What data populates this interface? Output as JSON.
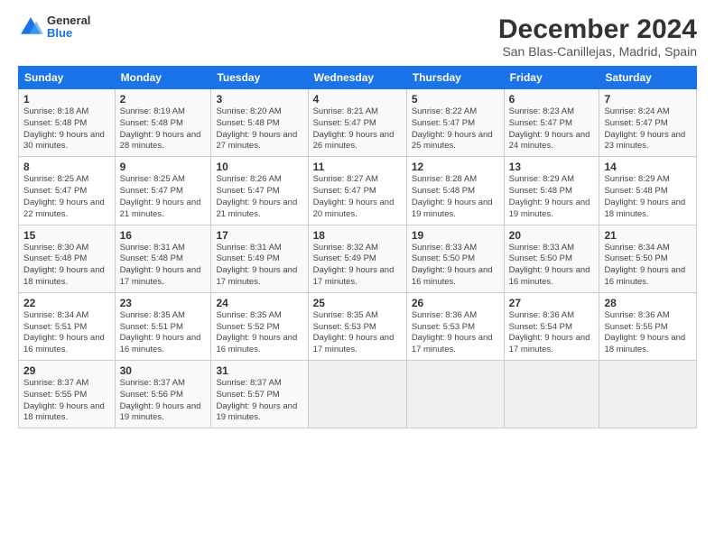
{
  "header": {
    "logo_general": "General",
    "logo_blue": "Blue",
    "title": "December 2024",
    "subtitle": "San Blas-Canillejas, Madrid, Spain"
  },
  "calendar": {
    "headers": [
      "Sunday",
      "Monday",
      "Tuesday",
      "Wednesday",
      "Thursday",
      "Friday",
      "Saturday"
    ],
    "weeks": [
      [
        {
          "day": "1",
          "sunrise": "8:18 AM",
          "sunset": "5:48 PM",
          "daylight": "9 hours and 30 minutes."
        },
        {
          "day": "2",
          "sunrise": "8:19 AM",
          "sunset": "5:48 PM",
          "daylight": "9 hours and 28 minutes."
        },
        {
          "day": "3",
          "sunrise": "8:20 AM",
          "sunset": "5:48 PM",
          "daylight": "9 hours and 27 minutes."
        },
        {
          "day": "4",
          "sunrise": "8:21 AM",
          "sunset": "5:47 PM",
          "daylight": "9 hours and 26 minutes."
        },
        {
          "day": "5",
          "sunrise": "8:22 AM",
          "sunset": "5:47 PM",
          "daylight": "9 hours and 25 minutes."
        },
        {
          "day": "6",
          "sunrise": "8:23 AM",
          "sunset": "5:47 PM",
          "daylight": "9 hours and 24 minutes."
        },
        {
          "day": "7",
          "sunrise": "8:24 AM",
          "sunset": "5:47 PM",
          "daylight": "9 hours and 23 minutes."
        }
      ],
      [
        {
          "day": "8",
          "sunrise": "8:25 AM",
          "sunset": "5:47 PM",
          "daylight": "9 hours and 22 minutes."
        },
        {
          "day": "9",
          "sunrise": "8:25 AM",
          "sunset": "5:47 PM",
          "daylight": "9 hours and 21 minutes."
        },
        {
          "day": "10",
          "sunrise": "8:26 AM",
          "sunset": "5:47 PM",
          "daylight": "9 hours and 21 minutes."
        },
        {
          "day": "11",
          "sunrise": "8:27 AM",
          "sunset": "5:47 PM",
          "daylight": "9 hours and 20 minutes."
        },
        {
          "day": "12",
          "sunrise": "8:28 AM",
          "sunset": "5:48 PM",
          "daylight": "9 hours and 19 minutes."
        },
        {
          "day": "13",
          "sunrise": "8:29 AM",
          "sunset": "5:48 PM",
          "daylight": "9 hours and 19 minutes."
        },
        {
          "day": "14",
          "sunrise": "8:29 AM",
          "sunset": "5:48 PM",
          "daylight": "9 hours and 18 minutes."
        }
      ],
      [
        {
          "day": "15",
          "sunrise": "8:30 AM",
          "sunset": "5:48 PM",
          "daylight": "9 hours and 18 minutes."
        },
        {
          "day": "16",
          "sunrise": "8:31 AM",
          "sunset": "5:48 PM",
          "daylight": "9 hours and 17 minutes."
        },
        {
          "day": "17",
          "sunrise": "8:31 AM",
          "sunset": "5:49 PM",
          "daylight": "9 hours and 17 minutes."
        },
        {
          "day": "18",
          "sunrise": "8:32 AM",
          "sunset": "5:49 PM",
          "daylight": "9 hours and 17 minutes."
        },
        {
          "day": "19",
          "sunrise": "8:33 AM",
          "sunset": "5:50 PM",
          "daylight": "9 hours and 16 minutes."
        },
        {
          "day": "20",
          "sunrise": "8:33 AM",
          "sunset": "5:50 PM",
          "daylight": "9 hours and 16 minutes."
        },
        {
          "day": "21",
          "sunrise": "8:34 AM",
          "sunset": "5:50 PM",
          "daylight": "9 hours and 16 minutes."
        }
      ],
      [
        {
          "day": "22",
          "sunrise": "8:34 AM",
          "sunset": "5:51 PM",
          "daylight": "9 hours and 16 minutes."
        },
        {
          "day": "23",
          "sunrise": "8:35 AM",
          "sunset": "5:51 PM",
          "daylight": "9 hours and 16 minutes."
        },
        {
          "day": "24",
          "sunrise": "8:35 AM",
          "sunset": "5:52 PM",
          "daylight": "9 hours and 16 minutes."
        },
        {
          "day": "25",
          "sunrise": "8:35 AM",
          "sunset": "5:53 PM",
          "daylight": "9 hours and 17 minutes."
        },
        {
          "day": "26",
          "sunrise": "8:36 AM",
          "sunset": "5:53 PM",
          "daylight": "9 hours and 17 minutes."
        },
        {
          "day": "27",
          "sunrise": "8:36 AM",
          "sunset": "5:54 PM",
          "daylight": "9 hours and 17 minutes."
        },
        {
          "day": "28",
          "sunrise": "8:36 AM",
          "sunset": "5:55 PM",
          "daylight": "9 hours and 18 minutes."
        }
      ],
      [
        {
          "day": "29",
          "sunrise": "8:37 AM",
          "sunset": "5:55 PM",
          "daylight": "9 hours and 18 minutes."
        },
        {
          "day": "30",
          "sunrise": "8:37 AM",
          "sunset": "5:56 PM",
          "daylight": "9 hours and 19 minutes."
        },
        {
          "day": "31",
          "sunrise": "8:37 AM",
          "sunset": "5:57 PM",
          "daylight": "9 hours and 19 minutes."
        },
        null,
        null,
        null,
        null
      ]
    ]
  }
}
